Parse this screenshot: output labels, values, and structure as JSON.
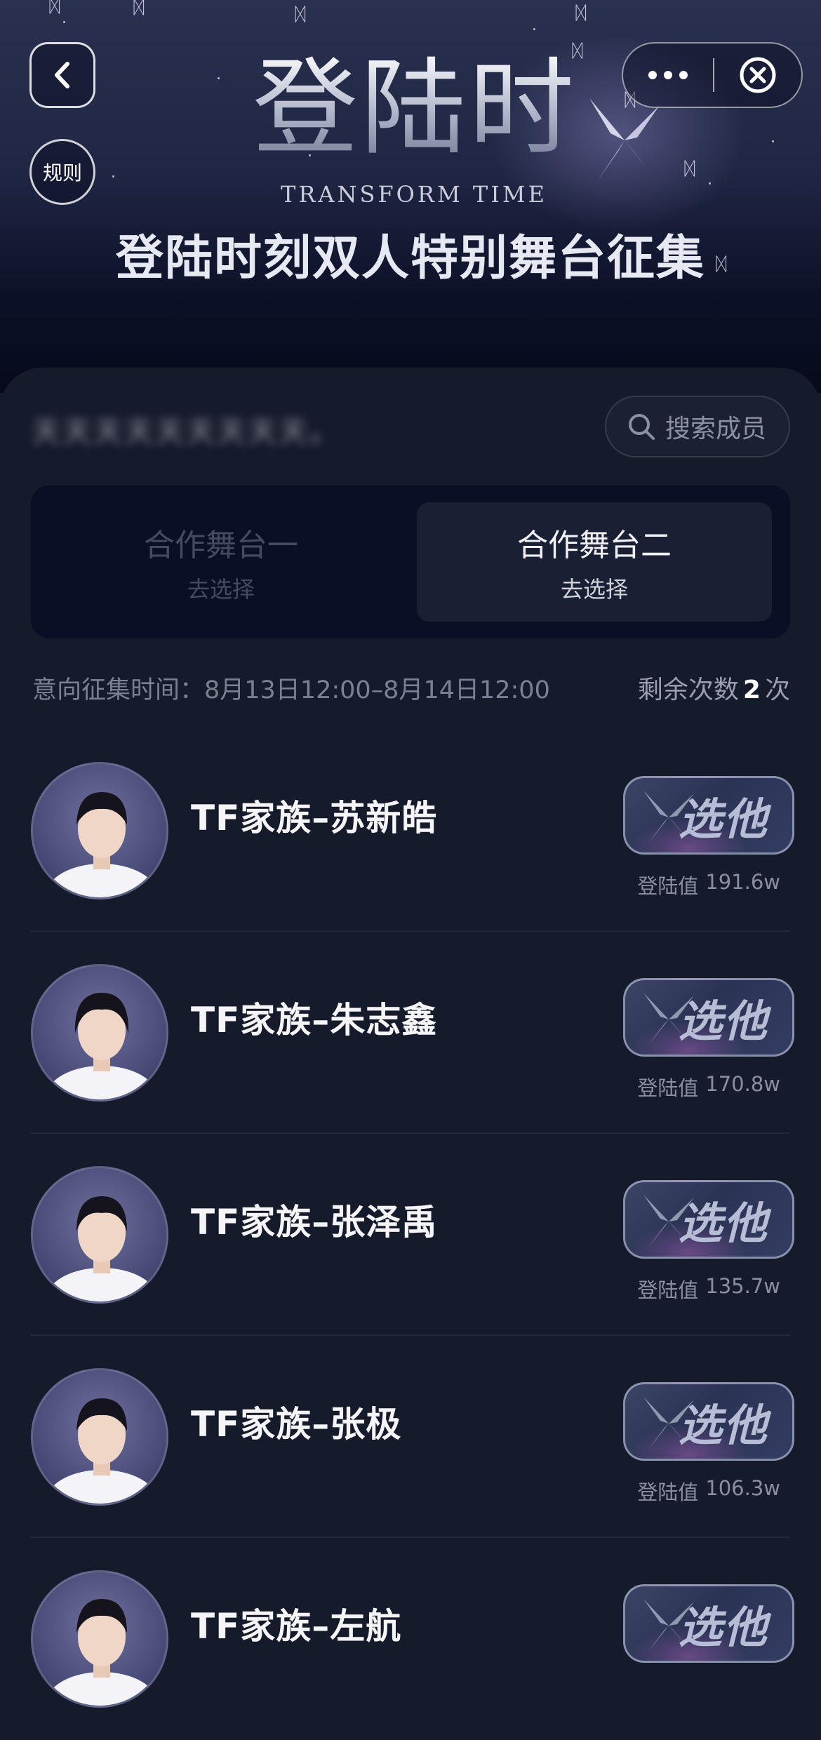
{
  "header": {
    "rules_label": "规则",
    "logo_title": "登陆时刻",
    "logo_subtitle": "TRANSFORM TIME",
    "banner_subtitle": "登陆时刻双人特别舞台征集",
    "icons": {
      "back": "chevron-left-icon",
      "more": "more-dots-icon",
      "close": "close-circle-icon"
    }
  },
  "user": {
    "blurred_text": "天天天天天天天天天。"
  },
  "search": {
    "placeholder": "搜索成员",
    "icon": "search-icon"
  },
  "stages": [
    {
      "label": "合作舞台一",
      "action": "去选择",
      "selected": false
    },
    {
      "label": "合作舞台二",
      "action": "去选择",
      "selected": true
    }
  ],
  "collection_time": "意向征集时间：8月13日12:00–8月14日12:00",
  "remaining": {
    "prefix": "剩余次数",
    "count": "2",
    "suffix": "次"
  },
  "members": [
    {
      "name": "TF家族–苏新皓",
      "button": "选他",
      "score_label": "登陆值",
      "score": "191.6w"
    },
    {
      "name": "TF家族–朱志鑫",
      "button": "选他",
      "score_label": "登陆值",
      "score": "170.8w"
    },
    {
      "name": "TF家族–张泽禹",
      "button": "选他",
      "score_label": "登陆值",
      "score": "135.7w"
    },
    {
      "name": "TF家族–张极",
      "button": "选他",
      "score_label": "登陆值",
      "score": "106.3w"
    },
    {
      "name": "TF家族–左航",
      "button": "选他",
      "score_label": "",
      "score": ""
    }
  ],
  "colors": {
    "background": "#161b2c",
    "panel": "#0a0f25",
    "accent_text": "#f5f5f8"
  }
}
